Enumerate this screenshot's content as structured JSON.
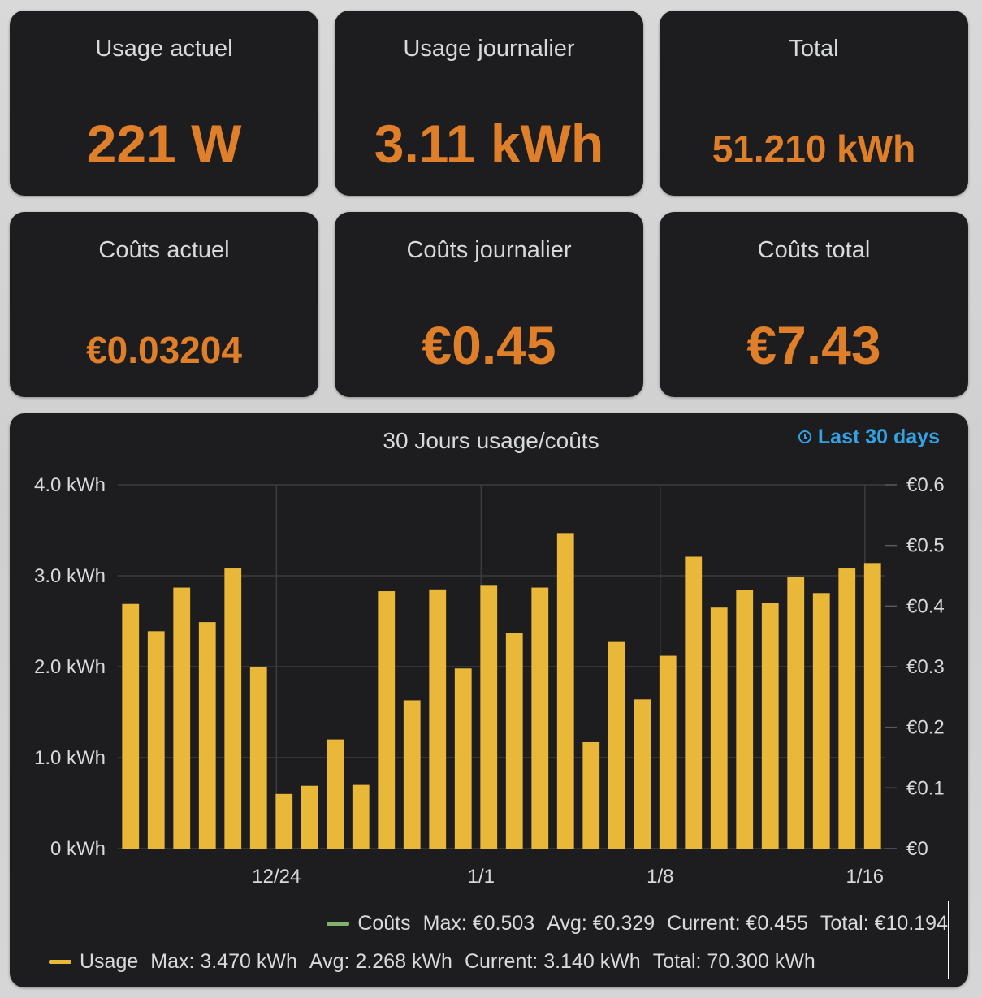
{
  "stats": [
    {
      "title": "Usage actuel",
      "value": "221 W",
      "size": "big"
    },
    {
      "title": "Usage journalier",
      "value": "3.11 kWh",
      "size": "big"
    },
    {
      "title": "Total",
      "value": "51.210 kWh",
      "size": "small"
    },
    {
      "title": "Coûts actuel",
      "value": "€0.03204",
      "size": "small"
    },
    {
      "title": "Coûts journalier",
      "value": "€0.45",
      "size": "big"
    },
    {
      "title": "Coûts total",
      "value": "€7.43",
      "size": "big"
    }
  ],
  "panel": {
    "title": "30 Jours usage/coûts",
    "time_range": "Last 30 days",
    "time_icon": "clock-icon"
  },
  "legend": {
    "costs": {
      "name": "Coûts",
      "max": "Max: €0.503",
      "avg": "Avg: €0.329",
      "current": "Current: €0.455",
      "total": "Total: €10.194",
      "color": "#7eb26d"
    },
    "usage": {
      "name": "Usage",
      "max": "Max: 3.470 kWh",
      "avg": "Avg: 2.268 kWh",
      "current": "Current: 3.140 kWh",
      "total": "Total: 70.300 kWh",
      "color": "#eab839"
    }
  },
  "colors": {
    "accent": "#e07f2a",
    "bar": "#eab839",
    "card": "#1d1d1f",
    "link": "#33a2e5"
  },
  "chart_data": {
    "type": "bar",
    "title": "30 Jours usage/coûts",
    "series": [
      {
        "name": "Usage",
        "unit": "kWh",
        "values": [
          2.69,
          2.39,
          2.87,
          2.49,
          3.08,
          2.0,
          0.6,
          0.69,
          1.2,
          0.7,
          2.83,
          1.63,
          2.85,
          1.98,
          2.89,
          2.37,
          2.87,
          3.47,
          1.17,
          2.28,
          1.64,
          2.12,
          3.21,
          2.65,
          2.84,
          2.7,
          2.99,
          2.81,
          3.08,
          3.14
        ]
      }
    ],
    "x_ticks": [
      {
        "label": "12/24",
        "index": 5.7
      },
      {
        "label": "1/1",
        "index": 13.7
      },
      {
        "label": "1/8",
        "index": 20.7
      },
      {
        "label": "1/16",
        "index": 28.7
      }
    ],
    "y_left": {
      "ticks": [
        "0 kWh",
        "1.0 kWh",
        "2.0 kWh",
        "3.0 kWh",
        "4.0 kWh"
      ],
      "ylim": [
        0,
        4
      ]
    },
    "y_right": {
      "ticks": [
        "€0",
        "€0.1",
        "€0.2",
        "€0.3",
        "€0.4",
        "€0.5",
        "€0.6"
      ],
      "ylim": [
        0,
        0.6
      ]
    },
    "grid": true,
    "legend_position": "bottom"
  }
}
